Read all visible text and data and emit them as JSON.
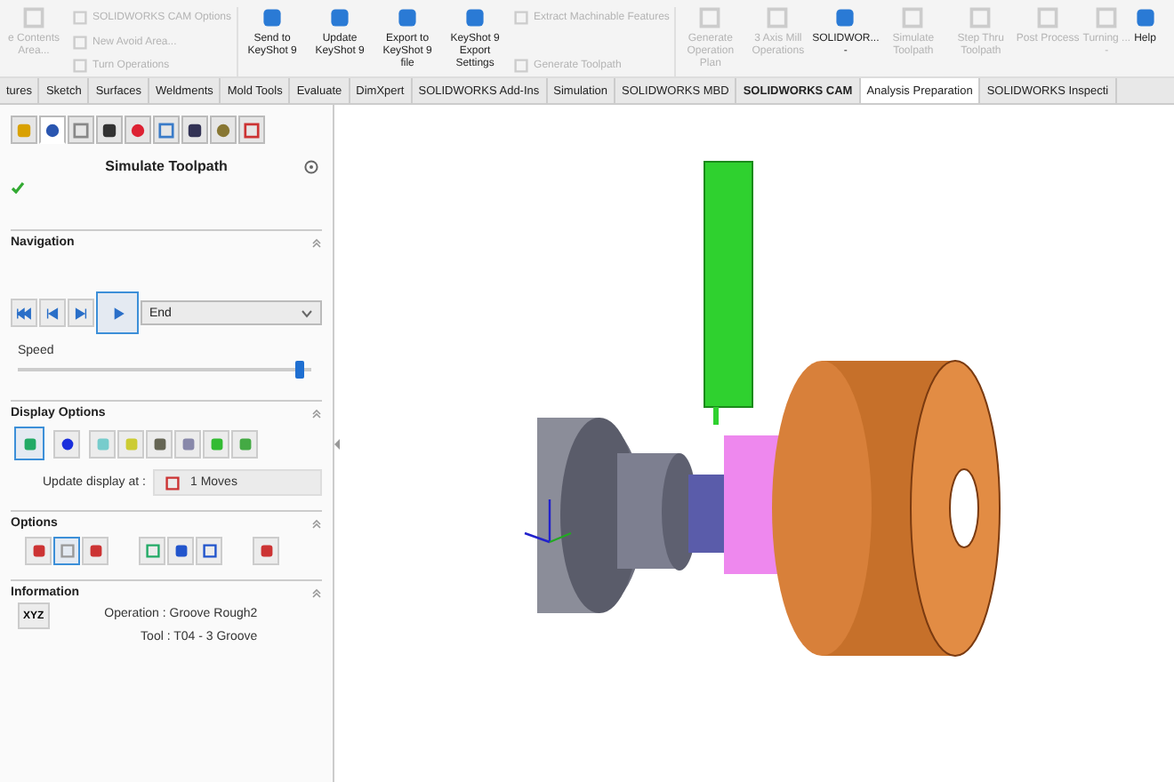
{
  "ribbon": [
    {
      "kind": "large",
      "label": "e Contents Area...",
      "disabled": true
    },
    {
      "kind": "stack",
      "items": [
        {
          "label": "SOLIDWORKS CAM Options",
          "disabled": true
        },
        {
          "label": "New Avoid Area...",
          "disabled": true
        },
        {
          "label": "Turn Operations",
          "disabled": true
        }
      ]
    },
    {
      "kind": "large",
      "label": "Send to KeyShot 9",
      "disabled": false
    },
    {
      "kind": "large",
      "label": "Update KeyShot 9",
      "disabled": false
    },
    {
      "kind": "large",
      "label": "Export to KeyShot 9 file",
      "disabled": false
    },
    {
      "kind": "large",
      "label": "KeyShot 9 Export Settings",
      "disabled": false
    },
    {
      "kind": "stack",
      "items": [
        {
          "label": "Extract Machinable Features",
          "disabled": true
        },
        {
          "label": "Generate Toolpath",
          "disabled": true
        }
      ]
    },
    {
      "kind": "large",
      "label": "Generate Operation Plan",
      "disabled": true
    },
    {
      "kind": "large",
      "label": "3 Axis Mill Operations",
      "disabled": true
    },
    {
      "kind": "large",
      "label": "SOLIDWOR...",
      "caret": "-",
      "disabled": false
    },
    {
      "kind": "large",
      "label": "Simulate Toolpath",
      "disabled": true
    },
    {
      "kind": "large",
      "label": "Step Thru Toolpath",
      "disabled": true
    },
    {
      "kind": "large",
      "label": "Post Process",
      "disabled": true
    },
    {
      "kind": "large",
      "label": "Turning ...",
      "caret": "-",
      "disabled": true
    },
    {
      "kind": "large",
      "label": "Help",
      "disabled": false
    }
  ],
  "tabs": [
    {
      "label": "tures",
      "selected": false,
      "bold": false
    },
    {
      "label": "Sketch",
      "selected": false,
      "bold": false
    },
    {
      "label": "Surfaces",
      "selected": false,
      "bold": false
    },
    {
      "label": "Weldments",
      "selected": false,
      "bold": false
    },
    {
      "label": "Mold Tools",
      "selected": false,
      "bold": false
    },
    {
      "label": "Evaluate",
      "selected": false,
      "bold": false
    },
    {
      "label": "DimXpert",
      "selected": false,
      "bold": false
    },
    {
      "label": "SOLIDWORKS Add-Ins",
      "selected": false,
      "bold": false
    },
    {
      "label": "Simulation",
      "selected": false,
      "bold": false
    },
    {
      "label": "SOLIDWORKS MBD",
      "selected": false,
      "bold": false
    },
    {
      "label": "SOLIDWORKS CAM",
      "selected": false,
      "bold": true
    },
    {
      "label": "Analysis Preparation",
      "selected": true,
      "bold": false
    },
    {
      "label": "SOLIDWORKS Inspecti",
      "selected": false,
      "bold": false
    }
  ],
  "panel": {
    "tabs": [
      {
        "selected": false
      },
      {
        "selected": true
      },
      {
        "selected": false
      },
      {
        "selected": false
      },
      {
        "selected": false
      },
      {
        "selected": false
      },
      {
        "selected": false
      },
      {
        "selected": false
      },
      {
        "selected": false
      }
    ],
    "title": "Simulate Toolpath",
    "navigation": {
      "title": "Navigation",
      "buttons": [
        {
          "selected": false
        },
        {
          "selected": false
        },
        {
          "selected": false
        },
        {
          "selected": true
        }
      ],
      "mode": "End",
      "speed_label": "Speed",
      "speed": {
        "level": 0.96
      }
    },
    "display_options": {
      "title": "Display Options",
      "buttons": [
        {
          "selected": true
        },
        {
          "selected": false
        },
        {
          "selected": false
        },
        {
          "selected": false
        },
        {
          "selected": false
        },
        {
          "selected": false
        },
        {
          "selected": false
        },
        {
          "selected": false
        }
      ],
      "update_label": "Update display at :",
      "update_value": "1 Moves"
    },
    "options": {
      "title": "Options",
      "buttons": [
        {
          "selected": false
        },
        {
          "selected": true
        },
        {
          "selected": false
        },
        {
          "selected": false
        },
        {
          "selected": false
        },
        {
          "selected": false
        },
        {
          "selected": false
        }
      ]
    },
    "information": {
      "title": "Information",
      "xyz": "XYZ",
      "operation": "Operation : Groove Rough2",
      "tool": "Tool : T04 - 3 Groove"
    }
  }
}
